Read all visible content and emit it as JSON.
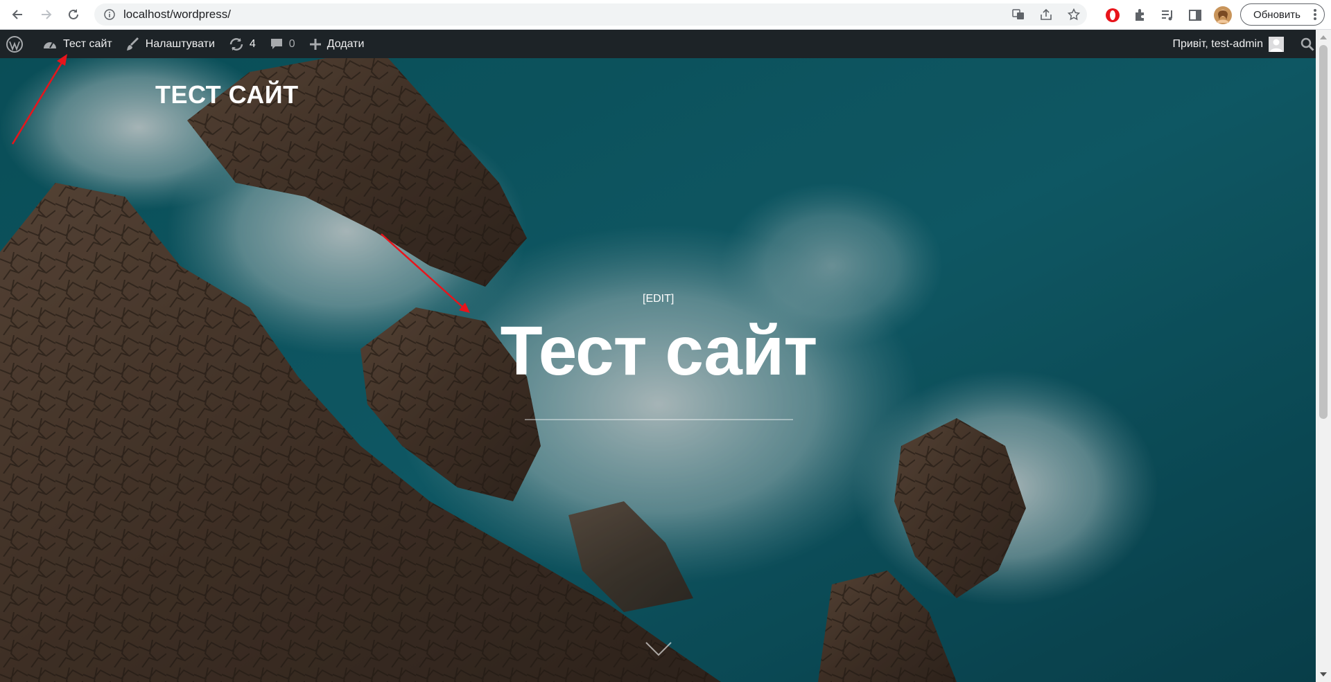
{
  "browser": {
    "url": "localhost/wordpress/",
    "update_label": "Обновить",
    "icons": [
      "back-icon",
      "forward-icon",
      "reload-icon",
      "info-icon",
      "translate-icon",
      "share-icon",
      "bookmark-star-icon",
      "opera-icon",
      "extensions-icon",
      "media-icon",
      "sidepanel-icon",
      "profile-avatar",
      "more-menu-icon"
    ]
  },
  "adminbar": {
    "site_name": "Тест сайт",
    "customize": "Налаштувати",
    "updates_count": "4",
    "comments_count": "0",
    "add_new": "Додати",
    "greeting": "Привіт, test-admin"
  },
  "hero": {
    "site_title": "ТЕСТ САЙТ",
    "edit_link": "[EDIT]",
    "title": "Тест сайт"
  },
  "colors": {
    "adminbar_bg": "#1d2327",
    "annotation_arrow": "#e8141b",
    "sea": "#0f5a6b",
    "rock": "#5a4536"
  }
}
